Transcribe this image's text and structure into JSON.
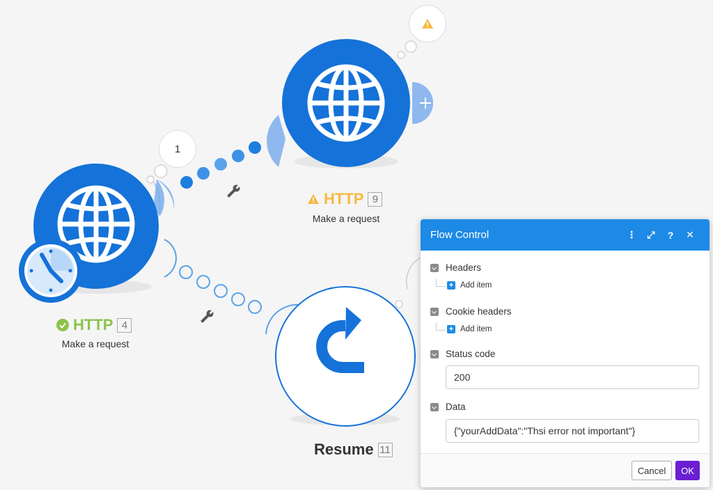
{
  "colors": {
    "accent": "#1d8ae6",
    "success": "#8bc34a",
    "warning": "#f5b942",
    "ok": "#6a1fd1"
  },
  "nodes": {
    "http4": {
      "name": "HTTP",
      "number": "4",
      "subtitle": "Make a request",
      "status_icon": "check-circle-icon"
    },
    "http9": {
      "name": "HTTP",
      "number": "9",
      "subtitle": "Make a request",
      "status_icon": "warning-icon"
    },
    "resume": {
      "name": "Resume",
      "number": "11"
    }
  },
  "bubbles": {
    "count_label": "1"
  },
  "panel": {
    "title": "Flow Control",
    "header_icons": [
      "more-icon",
      "expand-icon",
      "help-icon",
      "close-icon"
    ],
    "sections": {
      "headers": "Headers",
      "cookie_headers": "Cookie headers",
      "status_code": "Status code",
      "data": "Data"
    },
    "add_item": "Add item",
    "status_code_value": "200",
    "data_value": "{\"yourAddData\":\"Thsi error not important\"}",
    "cancel": "Cancel",
    "ok": "OK"
  }
}
